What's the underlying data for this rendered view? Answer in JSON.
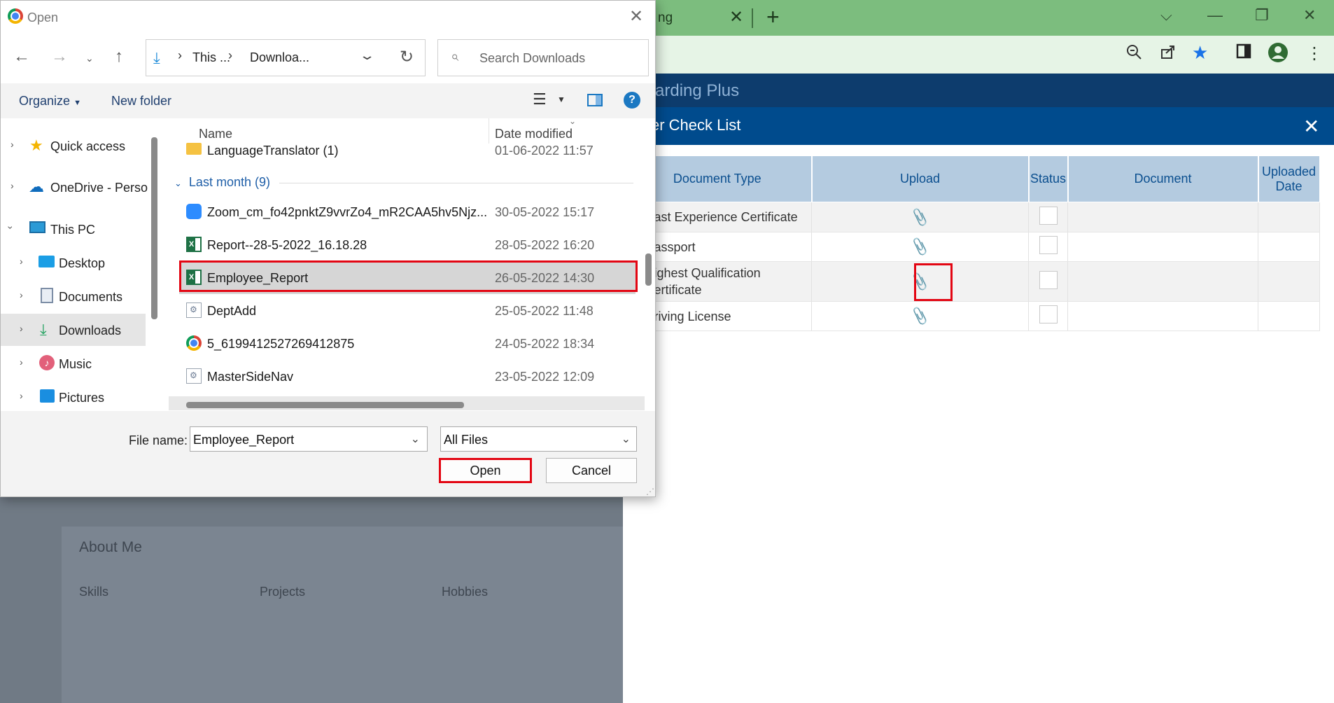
{
  "browser": {
    "tab_title": "ng",
    "app_title": "arding Plus",
    "about_title": "About Me",
    "about_links": [
      "Skills",
      "Projects",
      "Hobbies"
    ]
  },
  "modal": {
    "title": "er Check List",
    "headers": [
      "Document Type",
      "Upload",
      "Status",
      "Document",
      "Uploaded Date"
    ],
    "rows": [
      {
        "doc_type": "ast Experience Certificate"
      },
      {
        "doc_type": "assport"
      },
      {
        "doc_type": "ighest Qualification\nertificate",
        "line1": "ighest Qualification",
        "line2": "ertificate"
      },
      {
        "doc_type": "riving License"
      }
    ]
  },
  "dialog": {
    "title": "Open",
    "address": {
      "part1": "This ...",
      "part2": "Downloa..."
    },
    "search_placeholder": "Search Downloads",
    "commands": {
      "organize": "Organize",
      "new_folder": "New folder"
    },
    "nav": [
      {
        "label": "Quick access",
        "icon": "star-icon"
      },
      {
        "label": "OneDrive - Perso",
        "icon": "onedrive-cloud-icon"
      },
      {
        "label": "This PC",
        "icon": "computer-icon"
      },
      {
        "label": "Desktop",
        "icon": "desktop-icon"
      },
      {
        "label": "Documents",
        "icon": "documents-icon"
      },
      {
        "label": "Downloads",
        "icon": "download-icon"
      },
      {
        "label": "Music",
        "icon": "music-icon"
      },
      {
        "label": "Pictures",
        "icon": "pictures-icon"
      }
    ],
    "columns": {
      "name": "Name",
      "date": "Date modified"
    },
    "group": "Last month (9)",
    "files": [
      {
        "name": "LanguageTranslator (1)",
        "date": "01-06-2022 11:57",
        "icon": "folder-icon"
      },
      {
        "name": "Zoom_cm_fo42pnktZ9vvrZo4_mR2CAA5hv5Njz...",
        "date": "30-05-2022 15:17",
        "icon": "zoom-icon"
      },
      {
        "name": "Report--28-5-2022_16.18.28",
        "date": "28-05-2022 16:20",
        "icon": "excel-icon"
      },
      {
        "name": "Employee_Report",
        "date": "26-05-2022 14:30",
        "icon": "excel-icon"
      },
      {
        "name": "DeptAdd",
        "date": "25-05-2022 11:48",
        "icon": "config-file-icon"
      },
      {
        "name": "5_6199412527269412875",
        "date": "24-05-2022 18:34",
        "icon": "chrome-icon"
      },
      {
        "name": "MasterSideNav",
        "date": "23-05-2022 12:09",
        "icon": "config-file-icon"
      }
    ],
    "file_name_label": "File name:",
    "file_name_value": "Employee_Report",
    "file_type": "All Files",
    "open_label": "Open",
    "cancel_label": "Cancel"
  },
  "colors": {
    "tabbar": "#7cbd7e",
    "app_header": "#0d3c6d",
    "modal_header": "#004b8d",
    "table_header": "#b4cbe0",
    "highlight": "#e30613"
  }
}
